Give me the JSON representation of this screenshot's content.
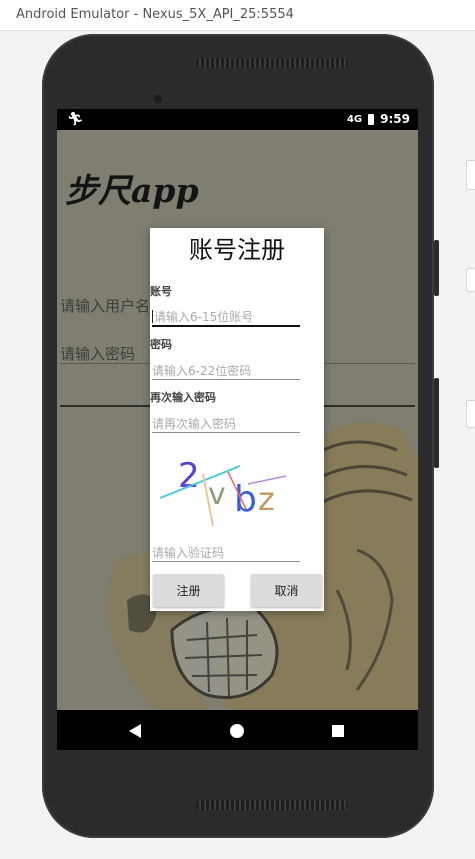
{
  "window": {
    "title": "Android Emulator - Nexus_5X_API_25:5554"
  },
  "status_bar": {
    "time": "9:59",
    "network": "4G",
    "icons": [
      "runner-icon",
      "signal-icon",
      "battery-icon"
    ]
  },
  "app": {
    "logo": "步尺app",
    "username_placeholder": "请输入用户名",
    "password_placeholder": "请输入密码"
  },
  "dialog": {
    "title": "账号注册",
    "account_label": "账号",
    "account_placeholder": "请输入6-15位账号",
    "password_label": "密码",
    "password_placeholder": "请输入6-22位密码",
    "confirm_label": "再次输入密码",
    "confirm_placeholder": "请再次输入密码",
    "captcha_text": "2vbz",
    "captcha_placeholder": "请输入验证码",
    "register_button": "注册",
    "cancel_button": "取消"
  },
  "navigation": {
    "icons": [
      "back-icon",
      "home-icon",
      "recents-icon"
    ]
  },
  "colors": {
    "dim_overlay": "#7f7e71",
    "phone_body": "#2b2b2b",
    "button_bg": "#dcdcdc"
  }
}
